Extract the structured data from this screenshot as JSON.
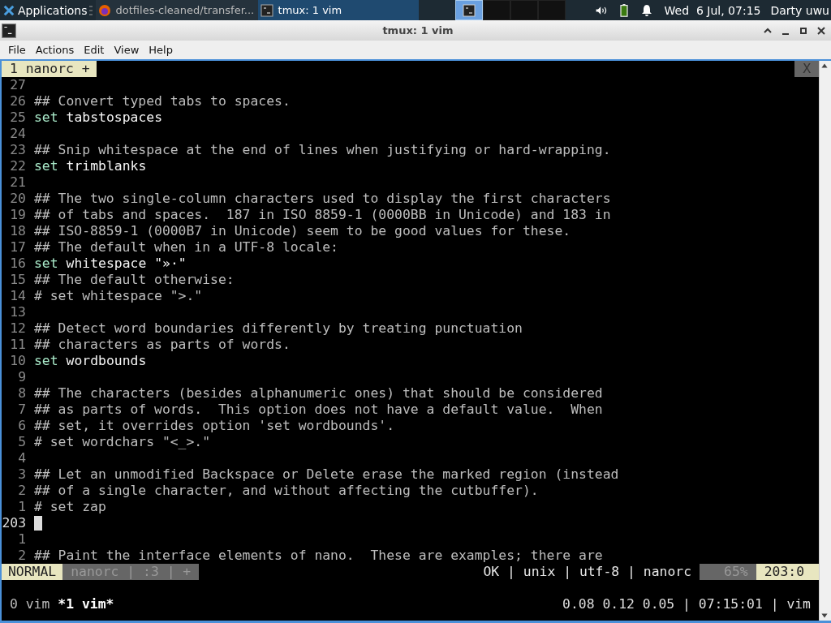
{
  "taskbar": {
    "menu_label": "Applications",
    "tasks": [
      {
        "title": "dotfiles-cleaned/transfer...",
        "kind": "browser",
        "selected": false
      },
      {
        "title": "tmux: 1 vim",
        "kind": "terminal",
        "selected": true
      }
    ],
    "workspaces": [
      {
        "selected": true
      },
      {
        "selected": false
      },
      {
        "selected": false
      },
      {
        "selected": false
      }
    ],
    "clock": "Wed  6 Jul, 07:15",
    "user": "Darty uwu"
  },
  "window": {
    "title": "tmux: 1 vim"
  },
  "menu": [
    "File",
    "Actions",
    "Edit",
    "View",
    "Help"
  ],
  "vim": {
    "tabs": [
      {
        "label": "1 nanorc +",
        "selected": true
      }
    ],
    "close_label": "X",
    "lines": [
      {
        "number": "27",
        "kind": "blank"
      },
      {
        "number": "26",
        "kind": "comment",
        "text": "## Convert typed tabs to spaces."
      },
      {
        "number": "25",
        "kind": "setting",
        "keyword": "set",
        "text": "tabstospaces"
      },
      {
        "number": "24",
        "kind": "blank"
      },
      {
        "number": "23",
        "kind": "comment",
        "text": "## Snip whitespace at the end of lines when justifying or hard-wrapping."
      },
      {
        "number": "22",
        "kind": "setting",
        "keyword": "set",
        "text": "trimblanks"
      },
      {
        "number": "21",
        "kind": "blank"
      },
      {
        "number": "20",
        "kind": "comment",
        "text": "## The two single-column characters used to display the first characters"
      },
      {
        "number": "19",
        "kind": "comment",
        "text": "## of tabs and spaces.  187 in ISO 8859-1 (0000BB in Unicode) and 183 in"
      },
      {
        "number": "18",
        "kind": "comment",
        "text": "## ISO-8859-1 (0000B7 in Unicode) seem to be good values for these."
      },
      {
        "number": "17",
        "kind": "comment",
        "text": "## The default when in a UTF-8 locale:"
      },
      {
        "number": "16",
        "kind": "setting",
        "keyword": "set",
        "text": "whitespace \"»·\""
      },
      {
        "number": "15",
        "kind": "comment",
        "text": "## The default otherwise:"
      },
      {
        "number": "14",
        "kind": "comment",
        "text": "# set whitespace \">.\""
      },
      {
        "number": "13",
        "kind": "blank"
      },
      {
        "number": "12",
        "kind": "comment",
        "text": "## Detect word boundaries differently by treating punctuation"
      },
      {
        "number": "11",
        "kind": "comment",
        "text": "## characters as parts of words."
      },
      {
        "number": "10",
        "kind": "setting",
        "keyword": "set",
        "text": "wordbounds"
      },
      {
        "number": "9",
        "kind": "blank"
      },
      {
        "number": "8",
        "kind": "comment",
        "text": "## The characters (besides alphanumeric ones) that should be considered"
      },
      {
        "number": "7",
        "kind": "comment",
        "text": "## as parts of words.  This option does not have a default value.  When"
      },
      {
        "number": "6",
        "kind": "comment",
        "text": "## set, it overrides option 'set wordbounds'."
      },
      {
        "number": "5",
        "kind": "comment",
        "text": "# set wordchars \"<_>.\""
      },
      {
        "number": "4",
        "kind": "blank"
      },
      {
        "number": "3",
        "kind": "comment",
        "text": "## Let an unmodified Backspace or Delete erase the marked region (instead"
      },
      {
        "number": "2",
        "kind": "comment",
        "text": "## of a single character, and without affecting the cutbuffer)."
      },
      {
        "number": "1",
        "kind": "comment",
        "text": "# set zap"
      },
      {
        "number": "203",
        "kind": "cursor"
      },
      {
        "number": "1",
        "kind": "blank"
      },
      {
        "number": "2",
        "kind": "comment",
        "text": "## Paint the interface elements of nano.  These are examples; there are"
      }
    ],
    "status": {
      "mode": "NORMAL",
      "file_info": "nanorc | :3 | +",
      "file_details": "OK | unix | utf-8 | nanorc",
      "percent": "65%",
      "position": "203:0"
    }
  },
  "tmux": {
    "windows": [
      {
        "label": "0 vim",
        "selected": false
      },
      {
        "label": "*1 vim*",
        "selected": true
      }
    ],
    "status_right": "0.08 0.12 0.05 | 07:15:01 | vim"
  }
}
